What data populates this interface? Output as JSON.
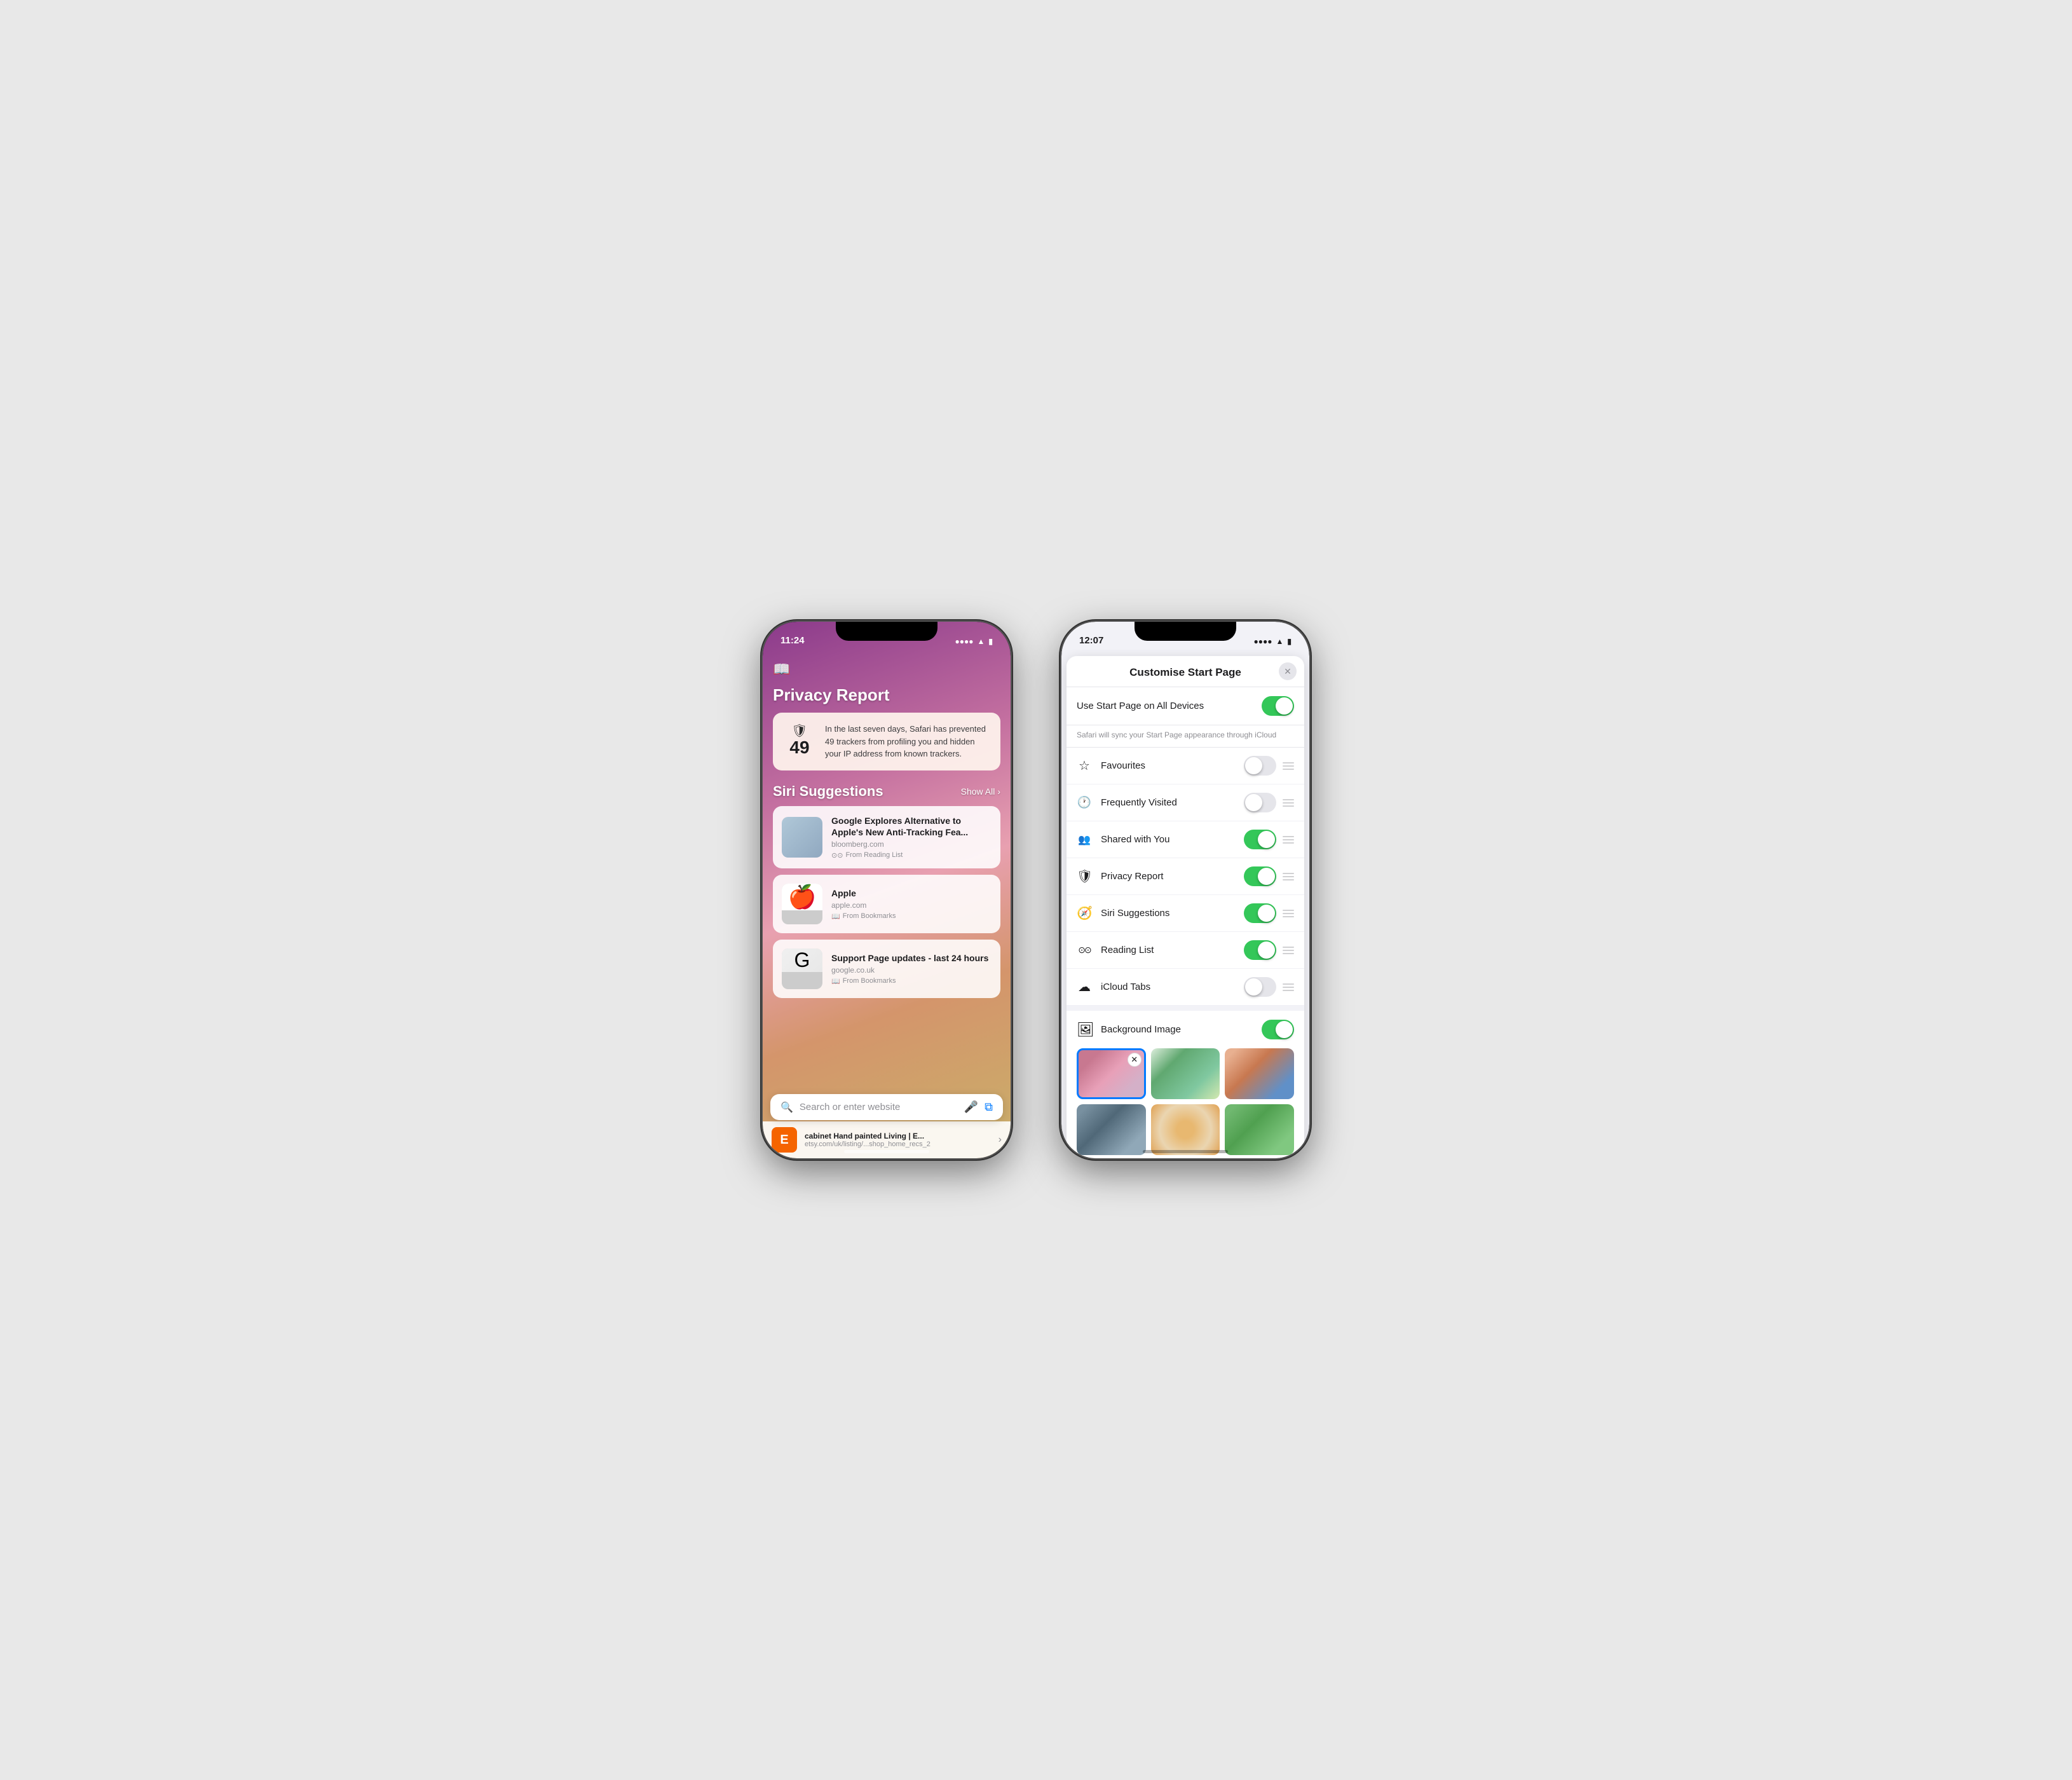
{
  "phone1": {
    "statusBar": {
      "time": "11:24",
      "signal": "....",
      "wifi": "wifi",
      "battery": "🔋"
    },
    "bookmarkIcon": "📖",
    "privacyReport": {
      "title": "Privacy Report",
      "card": {
        "trackerCount": "49",
        "shieldIcon": "🛡",
        "description": "In the last seven days, Safari has prevented 49 trackers from profiling you and hidden your IP address from known trackers."
      }
    },
    "siriSuggestions": {
      "title": "Siri Suggestions",
      "showAll": "Show All",
      "items": [
        {
          "title": "Google Explores Alternative to Apple's New Anti-Tracking Fea...",
          "domain": "bloomberg.com",
          "source": "From Reading List",
          "thumb": "photo"
        },
        {
          "title": "Apple",
          "domain": "apple.com",
          "source": "From Bookmarks",
          "thumb": "apple"
        },
        {
          "title": "Support Page updates - last 24 hours",
          "domain": "google.co.uk",
          "source": "From Bookmarks",
          "thumb": "google"
        }
      ]
    },
    "searchBar": {
      "placeholder": "Search or enter website"
    },
    "bottomStrip": {
      "title": "cabinet Hand painted Living | E...",
      "domain": "etsy.com/uk/listing/...shop_home_recs_2",
      "icon": "E"
    }
  },
  "phone2": {
    "statusBar": {
      "time": "12:07",
      "signal": "....",
      "wifi": "wifi",
      "battery": "🔋"
    },
    "sheet": {
      "title": "Customise Start Page",
      "closeIcon": "✕",
      "syncRow": {
        "label": "Use Start Page on All Devices",
        "enabled": true
      },
      "syncNote": "Safari will sync your Start Page appearance through iCloud",
      "rows": [
        {
          "icon": "☆",
          "label": "Favourites",
          "enabled": false
        },
        {
          "icon": "clock",
          "label": "Frequently Visited",
          "enabled": false
        },
        {
          "icon": "people",
          "label": "Shared with You",
          "enabled": true
        },
        {
          "icon": "shield",
          "label": "Privacy Report",
          "enabled": true
        },
        {
          "icon": "compass",
          "label": "Siri Suggestions",
          "enabled": true
        },
        {
          "icon": "glasses",
          "label": "Reading List",
          "enabled": true
        },
        {
          "icon": "cloud",
          "label": "iCloud Tabs",
          "enabled": false
        }
      ],
      "backgroundImage": {
        "label": "Background Image",
        "icon": "photo",
        "enabled": true,
        "selectedIndex": 0
      }
    }
  }
}
